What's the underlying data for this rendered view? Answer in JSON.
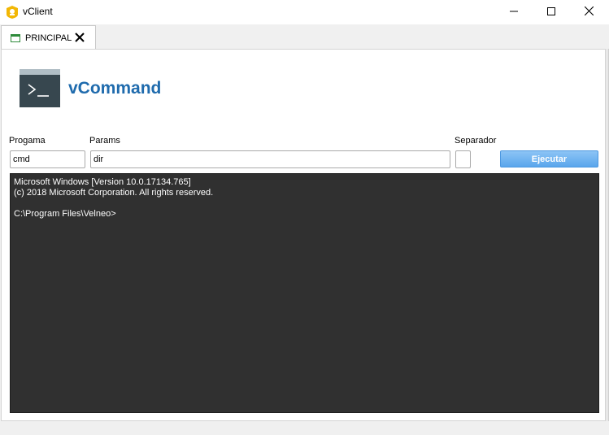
{
  "window": {
    "title": "vClient",
    "icon": "vclient-icon",
    "controls": [
      "minimize-icon",
      "maximize-icon",
      "close-icon"
    ]
  },
  "tabs": [
    {
      "label": "PRINCIPAL",
      "icon": "window-icon",
      "close_icon": "close-icon"
    }
  ],
  "header": {
    "title": "vCommand",
    "icon": "terminal-icon",
    "accent_color": "#1f6bad"
  },
  "form": {
    "program_label": "Progama",
    "program_value": "cmd",
    "params_label": "Params",
    "params_value": "dir",
    "separator_label": "Separador",
    "separator_value": "",
    "run_label": "Ejecutar",
    "run_color": "#5aa6ec"
  },
  "console": {
    "background": "#303030",
    "lines": [
      "Microsoft Windows [Version 10.0.17134.765]",
      "(c) 2018 Microsoft Corporation. All rights reserved.",
      "",
      "C:\\Program Files\\Velneo>"
    ]
  }
}
